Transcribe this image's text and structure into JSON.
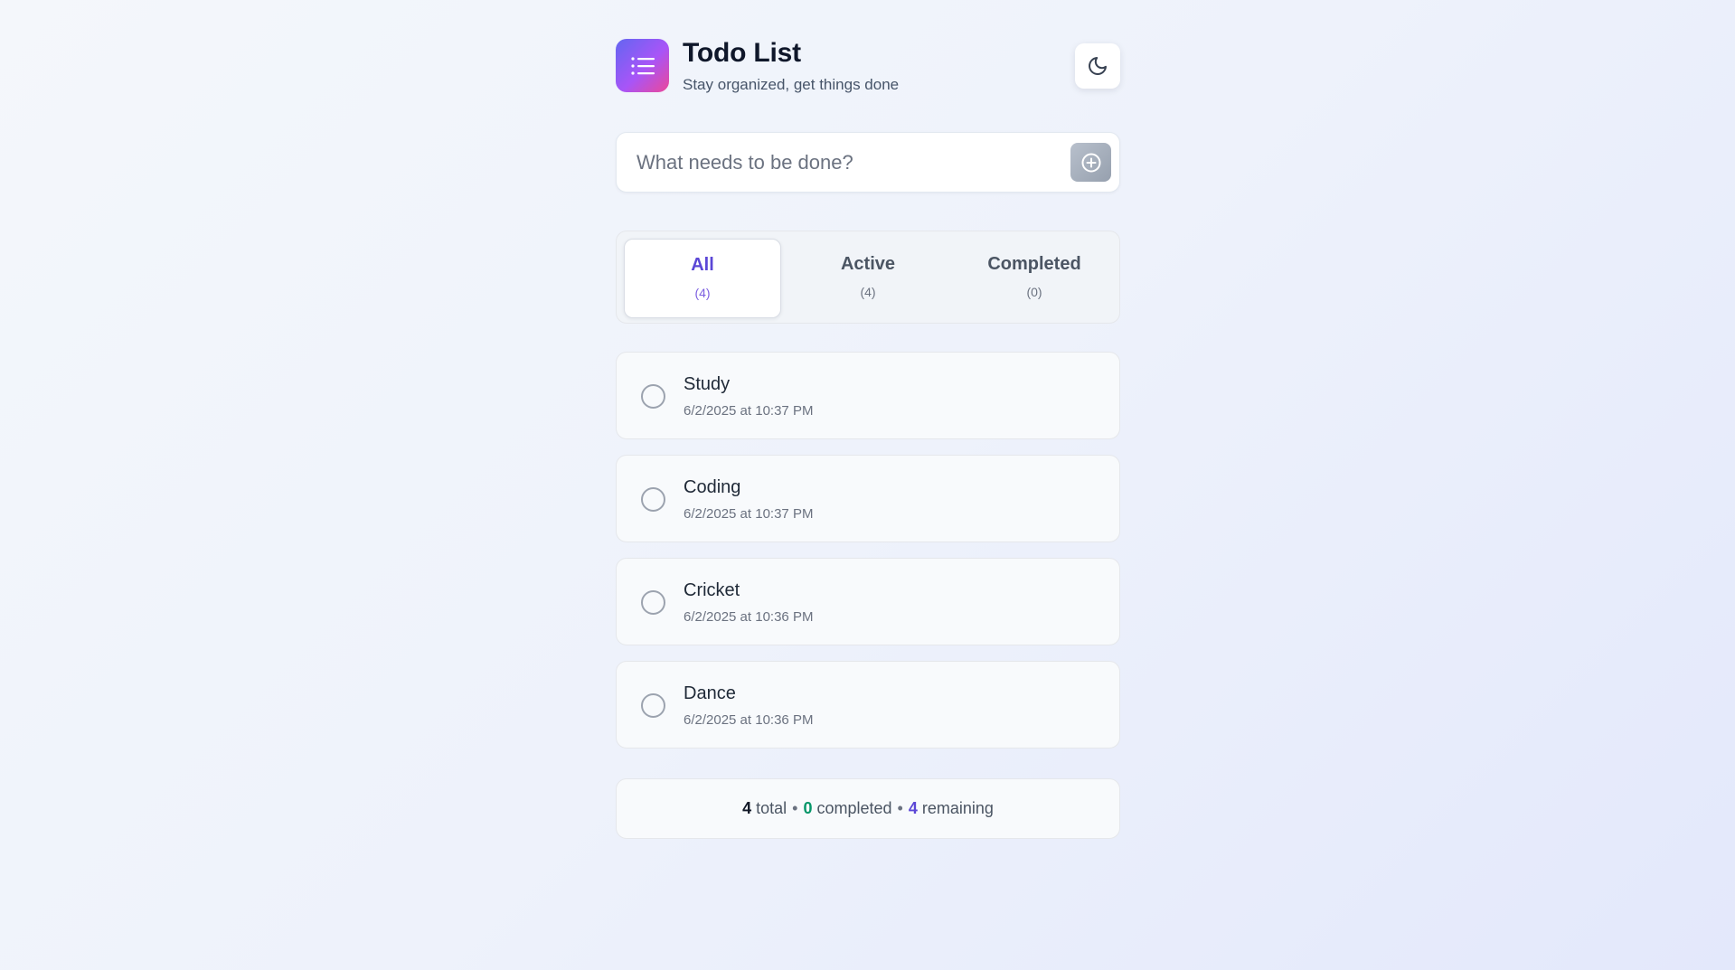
{
  "header": {
    "title": "Todo List",
    "subtitle": "Stay organized, get things done",
    "logo_icon": "list-icon",
    "theme_icon": "moon-icon"
  },
  "add": {
    "placeholder": "What needs to be done?",
    "icon": "plus-circle-icon"
  },
  "tabs": [
    {
      "label": "All",
      "count": "(4)",
      "active": true
    },
    {
      "label": "Active",
      "count": "(4)",
      "active": false
    },
    {
      "label": "Completed",
      "count": "(0)",
      "active": false
    }
  ],
  "todos": [
    {
      "title": "Study",
      "date": "6/2/2025 at 10:37 PM"
    },
    {
      "title": "Coding",
      "date": "6/2/2025 at 10:37 PM"
    },
    {
      "title": "Cricket",
      "date": "6/2/2025 at 10:36 PM"
    },
    {
      "title": "Dance",
      "date": "6/2/2025 at 10:36 PM"
    }
  ],
  "footer": {
    "total": "4",
    "total_label": "total",
    "completed": "0",
    "completed_label": "completed",
    "remaining": "4",
    "remaining_label": "remaining",
    "separator": "•"
  },
  "colors": {
    "accent": "#5b47d6",
    "success": "#059669",
    "logo_gradient": [
      "#6366f1",
      "#a855f7",
      "#ec4899"
    ]
  }
}
